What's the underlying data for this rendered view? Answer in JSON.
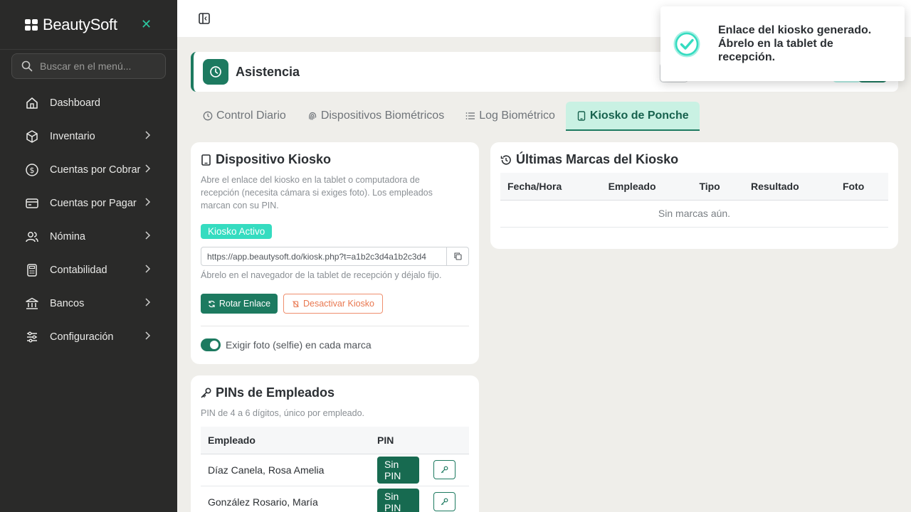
{
  "app": {
    "brand": "BeautySoft"
  },
  "search": {
    "placeholder": "Buscar en el menú..."
  },
  "sidebar": {
    "items": [
      {
        "label": "Dashboard",
        "icon": "home-icon",
        "has_submenu": false
      },
      {
        "label": "Inventario",
        "icon": "box-icon",
        "has_submenu": true
      },
      {
        "label": "Cuentas por Cobrar",
        "icon": "dollar-circle-icon",
        "has_submenu": true
      },
      {
        "label": "Cuentas por Pagar",
        "icon": "card-icon",
        "has_submenu": true
      },
      {
        "label": "Nómina",
        "icon": "users-icon",
        "has_submenu": true
      },
      {
        "label": "Contabilidad",
        "icon": "calculator-icon",
        "has_submenu": true
      },
      {
        "label": "Bancos",
        "icon": "bank-icon",
        "has_submenu": true
      },
      {
        "label": "Configuración",
        "icon": "sliders-icon",
        "has_submenu": true
      }
    ]
  },
  "page": {
    "title": "Asistencia"
  },
  "tabs": [
    {
      "label": "Control Diario",
      "icon": "clock-icon",
      "active": false
    },
    {
      "label": "Dispositivos Biométricos",
      "icon": "fingerprint-icon",
      "active": false
    },
    {
      "label": "Log Biométrico",
      "icon": "list-icon",
      "active": false
    },
    {
      "label": "Kiosko de Ponche",
      "icon": "tablet-icon",
      "active": true
    }
  ],
  "kiosk": {
    "title": "Dispositivo Kiosko",
    "description": "Abre el enlace del kiosko en la tablet o computadora de recepción (necesita cámara si exiges foto). Los empleados marcan con su PIN.",
    "status_badge": "Kiosko Activo",
    "url": "https://app.beautysoft.do/kiosk.php?t=a1b2c3d4a1b2c3d4",
    "url_hint": "Ábrelo en el navegador de la tablet de recepción y déjalo fijo.",
    "rotate_label": "Rotar Enlace",
    "deactivate_label": "Desactivar Kiosko",
    "photo_toggle_label": "Exigir foto (selfie) en cada marca",
    "photo_toggle_on": true
  },
  "marks": {
    "title": "Últimas Marcas del Kiosko",
    "columns": [
      "Fecha/Hora",
      "Empleado",
      "Tipo",
      "Resultado",
      "Foto"
    ],
    "empty": "Sin marcas aún."
  },
  "pins": {
    "title": "PINs de Empleados",
    "subtitle": "PIN de 4 a 6 dígitos, único por empleado.",
    "columns": [
      "Empleado",
      "PIN"
    ],
    "rows": [
      {
        "employee": "Díaz Canela, Rosa Amelia",
        "pin": "Sin PIN"
      },
      {
        "employee": "González Rosario, María",
        "pin": "Sin PIN"
      }
    ]
  },
  "toast": {
    "message": "Enlace del kiosko generado. Ábrelo en la tablet de recepción."
  },
  "colors": {
    "sidebar_bg": "#2a2a29",
    "primary": "#1d7a60",
    "accent": "#35dcc0",
    "danger": "#e9774f",
    "tab_active_bg": "#c9f1e3"
  }
}
